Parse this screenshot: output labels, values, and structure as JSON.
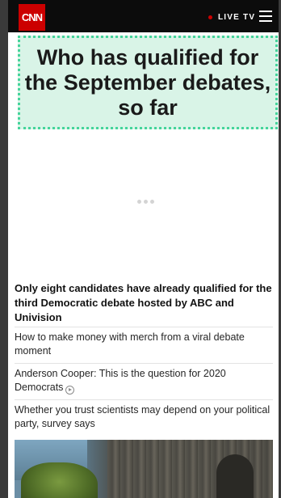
{
  "header": {
    "logo_text": "CNN",
    "live_label": "LIVE TV",
    "accent_color": "#cc0000"
  },
  "headline_card": {
    "title": "Who has qualified for the September debates, so far",
    "background": "#d9f4e7",
    "border_color": "#45d49b"
  },
  "article": {
    "summary": "Only eight candidates have already qualified for the third Democratic debate hosted by ABC and Univision"
  },
  "related": [
    {
      "text": "How to make money with merch from a viral debate moment",
      "has_video": false
    },
    {
      "text": "Anderson Cooper: This is the question for 2020 Democrats",
      "has_video": true,
      "icon": "play-circle-icon"
    },
    {
      "text": "Whether you trust scientists may depend on your political party, survey says",
      "has_video": false
    }
  ]
}
